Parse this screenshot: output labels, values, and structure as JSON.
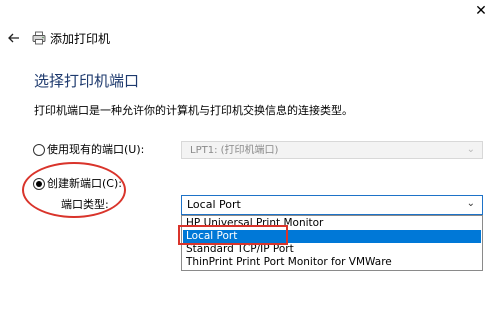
{
  "window": {
    "close_glyph": "✕"
  },
  "header": {
    "title": "添加打印机"
  },
  "page": {
    "heading": "选择打印机端口",
    "description": "打印机端口是一种允许你的计算机与打印机交换信息的连接类型。"
  },
  "options": {
    "existing_port": {
      "label": "使用现有的端口(U):",
      "selected": false,
      "value": "LPT1: (打印机端口)"
    },
    "new_port": {
      "label": "创建新端口(C):",
      "selected": true,
      "type_label": "端口类型:",
      "value": "Local Port"
    }
  },
  "dropdown": {
    "options": [
      {
        "label": "HP Universal Print Monitor",
        "selected": false
      },
      {
        "label": "Local Port",
        "selected": true
      },
      {
        "label": "Standard TCP/IP Port",
        "selected": false
      },
      {
        "label": "ThinPrint Print Port Monitor for VMWare",
        "selected": false
      }
    ]
  },
  "colors": {
    "heading": "#1e3a6e",
    "selection": "#0078d7",
    "annotation": "#d9342b",
    "focus_border": "#1e73c8"
  },
  "icons": {
    "back": "back-arrow-icon",
    "printer": "printer-icon",
    "close": "close-icon"
  }
}
